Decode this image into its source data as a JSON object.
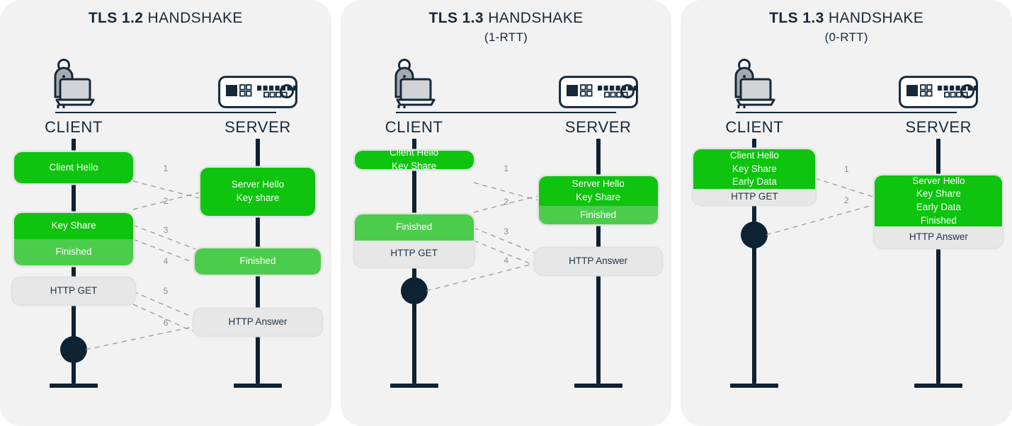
{
  "panels": [
    {
      "title_strong": "TLS 1.2",
      "title_rest": " HANDSHAKE",
      "subtitle": "",
      "client_label": "CLIENT",
      "server_label": "SERVER",
      "client_icon": "person-with-laptop-icon",
      "server_icon": "server-rack-icon",
      "cards": [
        {
          "side": "client",
          "segments": [
            {
              "text": "Client Hello",
              "tone": "green"
            }
          ]
        },
        {
          "side": "server",
          "segments": [
            {
              "text": "Server Hello\nKey share",
              "tone": "green"
            }
          ]
        },
        {
          "side": "client",
          "segments": [
            {
              "text": "Key Share",
              "tone": "green"
            },
            {
              "text": "Finished",
              "tone": "lgreen"
            }
          ]
        },
        {
          "side": "server",
          "segments": [
            {
              "text": "Finished",
              "tone": "lgreen"
            }
          ]
        },
        {
          "side": "client",
          "segments": [
            {
              "text": "HTTP GET",
              "tone": "gray"
            }
          ]
        },
        {
          "side": "server",
          "segments": [
            {
              "text": "HTTP Answer",
              "tone": "gray"
            }
          ]
        }
      ],
      "steps": [
        "1",
        "2",
        "3",
        "4",
        "5",
        "6"
      ]
    },
    {
      "title_strong": "TLS 1.3",
      "title_rest": " HANDSHAKE",
      "subtitle": "(1-RTT)",
      "client_label": "CLIENT",
      "server_label": "SERVER",
      "client_icon": "person-with-laptop-icon",
      "server_icon": "server-rack-icon",
      "cards": [
        {
          "side": "client",
          "segments": [
            {
              "text": "Client Hello\nKey Share",
              "tone": "green"
            }
          ]
        },
        {
          "side": "server",
          "segments": [
            {
              "text": "Server Hello\nKey Share",
              "tone": "green"
            },
            {
              "text": "Finished",
              "tone": "lgreen"
            }
          ]
        },
        {
          "side": "client",
          "segments": [
            {
              "text": "Finished",
              "tone": "lgreen"
            },
            {
              "text": "HTTP GET",
              "tone": "gray"
            }
          ]
        },
        {
          "side": "server",
          "segments": [
            {
              "text": "HTTP Answer",
              "tone": "gray"
            }
          ]
        }
      ],
      "steps": [
        "1",
        "2",
        "3",
        "4"
      ]
    },
    {
      "title_strong": "TLS 1.3",
      "title_rest": " HANDSHAKE",
      "subtitle": "(0-RTT)",
      "client_label": "CLIENT",
      "server_label": "SERVER",
      "client_icon": "person-with-laptop-icon",
      "server_icon": "server-rack-icon",
      "cards": [
        {
          "side": "client",
          "segments": [
            {
              "text": "Client Hello\nKey Share\nEarly Data",
              "tone": "green"
            },
            {
              "text": "HTTP GET",
              "tone": "gray"
            }
          ]
        },
        {
          "side": "server",
          "segments": [
            {
              "text": "Server Hello\nKey Share\nEarly Data\nFinished",
              "tone": "green"
            },
            {
              "text": "HTTP Answer",
              "tone": "gray"
            }
          ]
        }
      ],
      "steps": [
        "1",
        "2"
      ]
    }
  ],
  "colors": {
    "panel_background": "#f2f2f2",
    "page_background": "#ffffff",
    "ink": "#16293b",
    "lane": "#0d2233",
    "green": "#0ec40e",
    "light_green": "#4ccc4c",
    "gray_card": "#e7e7e7",
    "dash": "#9a9a9a",
    "step_number": "#8d8d8d"
  }
}
